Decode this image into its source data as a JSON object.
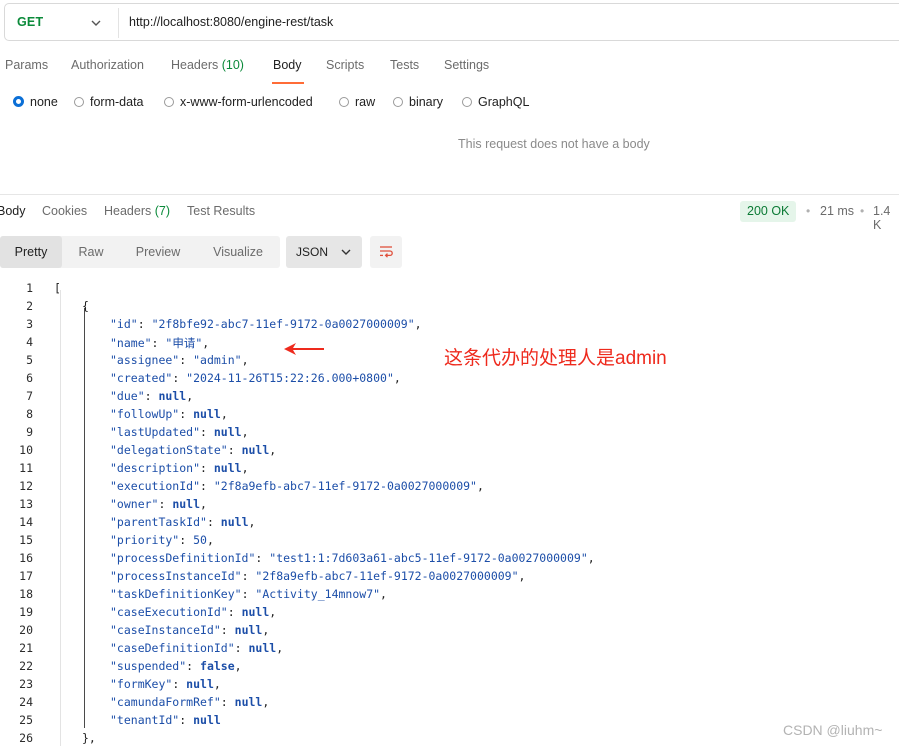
{
  "request": {
    "method": "GET",
    "url": "http://localhost:8080/engine-rest/task"
  },
  "request_tabs": [
    {
      "label": "Params",
      "count": ""
    },
    {
      "label": "Authorization",
      "count": ""
    },
    {
      "label": "Headers",
      "count": "(10)"
    },
    {
      "label": "Body",
      "count": ""
    },
    {
      "label": "Scripts",
      "count": ""
    },
    {
      "label": "Tests",
      "count": ""
    },
    {
      "label": "Settings",
      "count": ""
    }
  ],
  "body_types": [
    "none",
    "form-data",
    "x-www-form-urlencoded",
    "raw",
    "binary",
    "GraphQL"
  ],
  "empty_body_message": "This request does not have a body",
  "response_tabs": [
    {
      "label": "Body",
      "count": ""
    },
    {
      "label": "Cookies",
      "count": ""
    },
    {
      "label": "Headers",
      "count": "(7)"
    },
    {
      "label": "Test Results",
      "count": ""
    }
  ],
  "response_meta": {
    "status": "200 OK",
    "time": "21 ms",
    "size": "1.4 K"
  },
  "view_tabs": [
    "Pretty",
    "Raw",
    "Preview",
    "Visualize"
  ],
  "format": "JSON",
  "code_lines": [
    {
      "n": "1",
      "indent": 0,
      "key": "",
      "value": "[",
      "vtype": "p"
    },
    {
      "n": "2",
      "indent": 1,
      "key": "",
      "value": "{",
      "vtype": "p"
    },
    {
      "n": "3",
      "indent": 2,
      "key": "\"id\"",
      "value": "\"2f8bfe92-abc7-11ef-9172-0a0027000009\"",
      "vtype": "s",
      "comma": true
    },
    {
      "n": "4",
      "indent": 2,
      "key": "\"name\"",
      "value": "\"申请\"",
      "vtype": "s",
      "comma": true
    },
    {
      "n": "5",
      "indent": 2,
      "key": "\"assignee\"",
      "value": "\"admin\"",
      "vtype": "s",
      "comma": true
    },
    {
      "n": "6",
      "indent": 2,
      "key": "\"created\"",
      "value": "\"2024-11-26T15:22:26.000+0800\"",
      "vtype": "s",
      "comma": true
    },
    {
      "n": "7",
      "indent": 2,
      "key": "\"due\"",
      "value": "null",
      "vtype": "kw",
      "comma": true
    },
    {
      "n": "8",
      "indent": 2,
      "key": "\"followUp\"",
      "value": "null",
      "vtype": "kw",
      "comma": true
    },
    {
      "n": "9",
      "indent": 2,
      "key": "\"lastUpdated\"",
      "value": "null",
      "vtype": "kw",
      "comma": true
    },
    {
      "n": "10",
      "indent": 2,
      "key": "\"delegationState\"",
      "value": "null",
      "vtype": "kw",
      "comma": true
    },
    {
      "n": "11",
      "indent": 2,
      "key": "\"description\"",
      "value": "null",
      "vtype": "kw",
      "comma": true
    },
    {
      "n": "12",
      "indent": 2,
      "key": "\"executionId\"",
      "value": "\"2f8a9efb-abc7-11ef-9172-0a0027000009\"",
      "vtype": "s",
      "comma": true
    },
    {
      "n": "13",
      "indent": 2,
      "key": "\"owner\"",
      "value": "null",
      "vtype": "kw",
      "comma": true
    },
    {
      "n": "14",
      "indent": 2,
      "key": "\"parentTaskId\"",
      "value": "null",
      "vtype": "kw",
      "comma": true
    },
    {
      "n": "15",
      "indent": 2,
      "key": "\"priority\"",
      "value": "50",
      "vtype": "n",
      "comma": true
    },
    {
      "n": "16",
      "indent": 2,
      "key": "\"processDefinitionId\"",
      "value": "\"test1:1:7d603a61-abc5-11ef-9172-0a0027000009\"",
      "vtype": "s",
      "comma": true
    },
    {
      "n": "17",
      "indent": 2,
      "key": "\"processInstanceId\"",
      "value": "\"2f8a9efb-abc7-11ef-9172-0a0027000009\"",
      "vtype": "s",
      "comma": true
    },
    {
      "n": "18",
      "indent": 2,
      "key": "\"taskDefinitionKey\"",
      "value": "\"Activity_14mnow7\"",
      "vtype": "s",
      "comma": true
    },
    {
      "n": "19",
      "indent": 2,
      "key": "\"caseExecutionId\"",
      "value": "null",
      "vtype": "kw",
      "comma": true
    },
    {
      "n": "20",
      "indent": 2,
      "key": "\"caseInstanceId\"",
      "value": "null",
      "vtype": "kw",
      "comma": true
    },
    {
      "n": "21",
      "indent": 2,
      "key": "\"caseDefinitionId\"",
      "value": "null",
      "vtype": "kw",
      "comma": true
    },
    {
      "n": "22",
      "indent": 2,
      "key": "\"suspended\"",
      "value": "false",
      "vtype": "kw",
      "comma": true
    },
    {
      "n": "23",
      "indent": 2,
      "key": "\"formKey\"",
      "value": "null",
      "vtype": "kw",
      "comma": true
    },
    {
      "n": "24",
      "indent": 2,
      "key": "\"camundaFormRef\"",
      "value": "null",
      "vtype": "kw",
      "comma": true
    },
    {
      "n": "25",
      "indent": 2,
      "key": "\"tenantId\"",
      "value": "null",
      "vtype": "kw",
      "comma": false
    },
    {
      "n": "26",
      "indent": 1,
      "key": "",
      "value": "},",
      "vtype": "p"
    }
  ],
  "annotation": "这条代办的处理人是admin",
  "watermark": "CSDN @liuhm~"
}
